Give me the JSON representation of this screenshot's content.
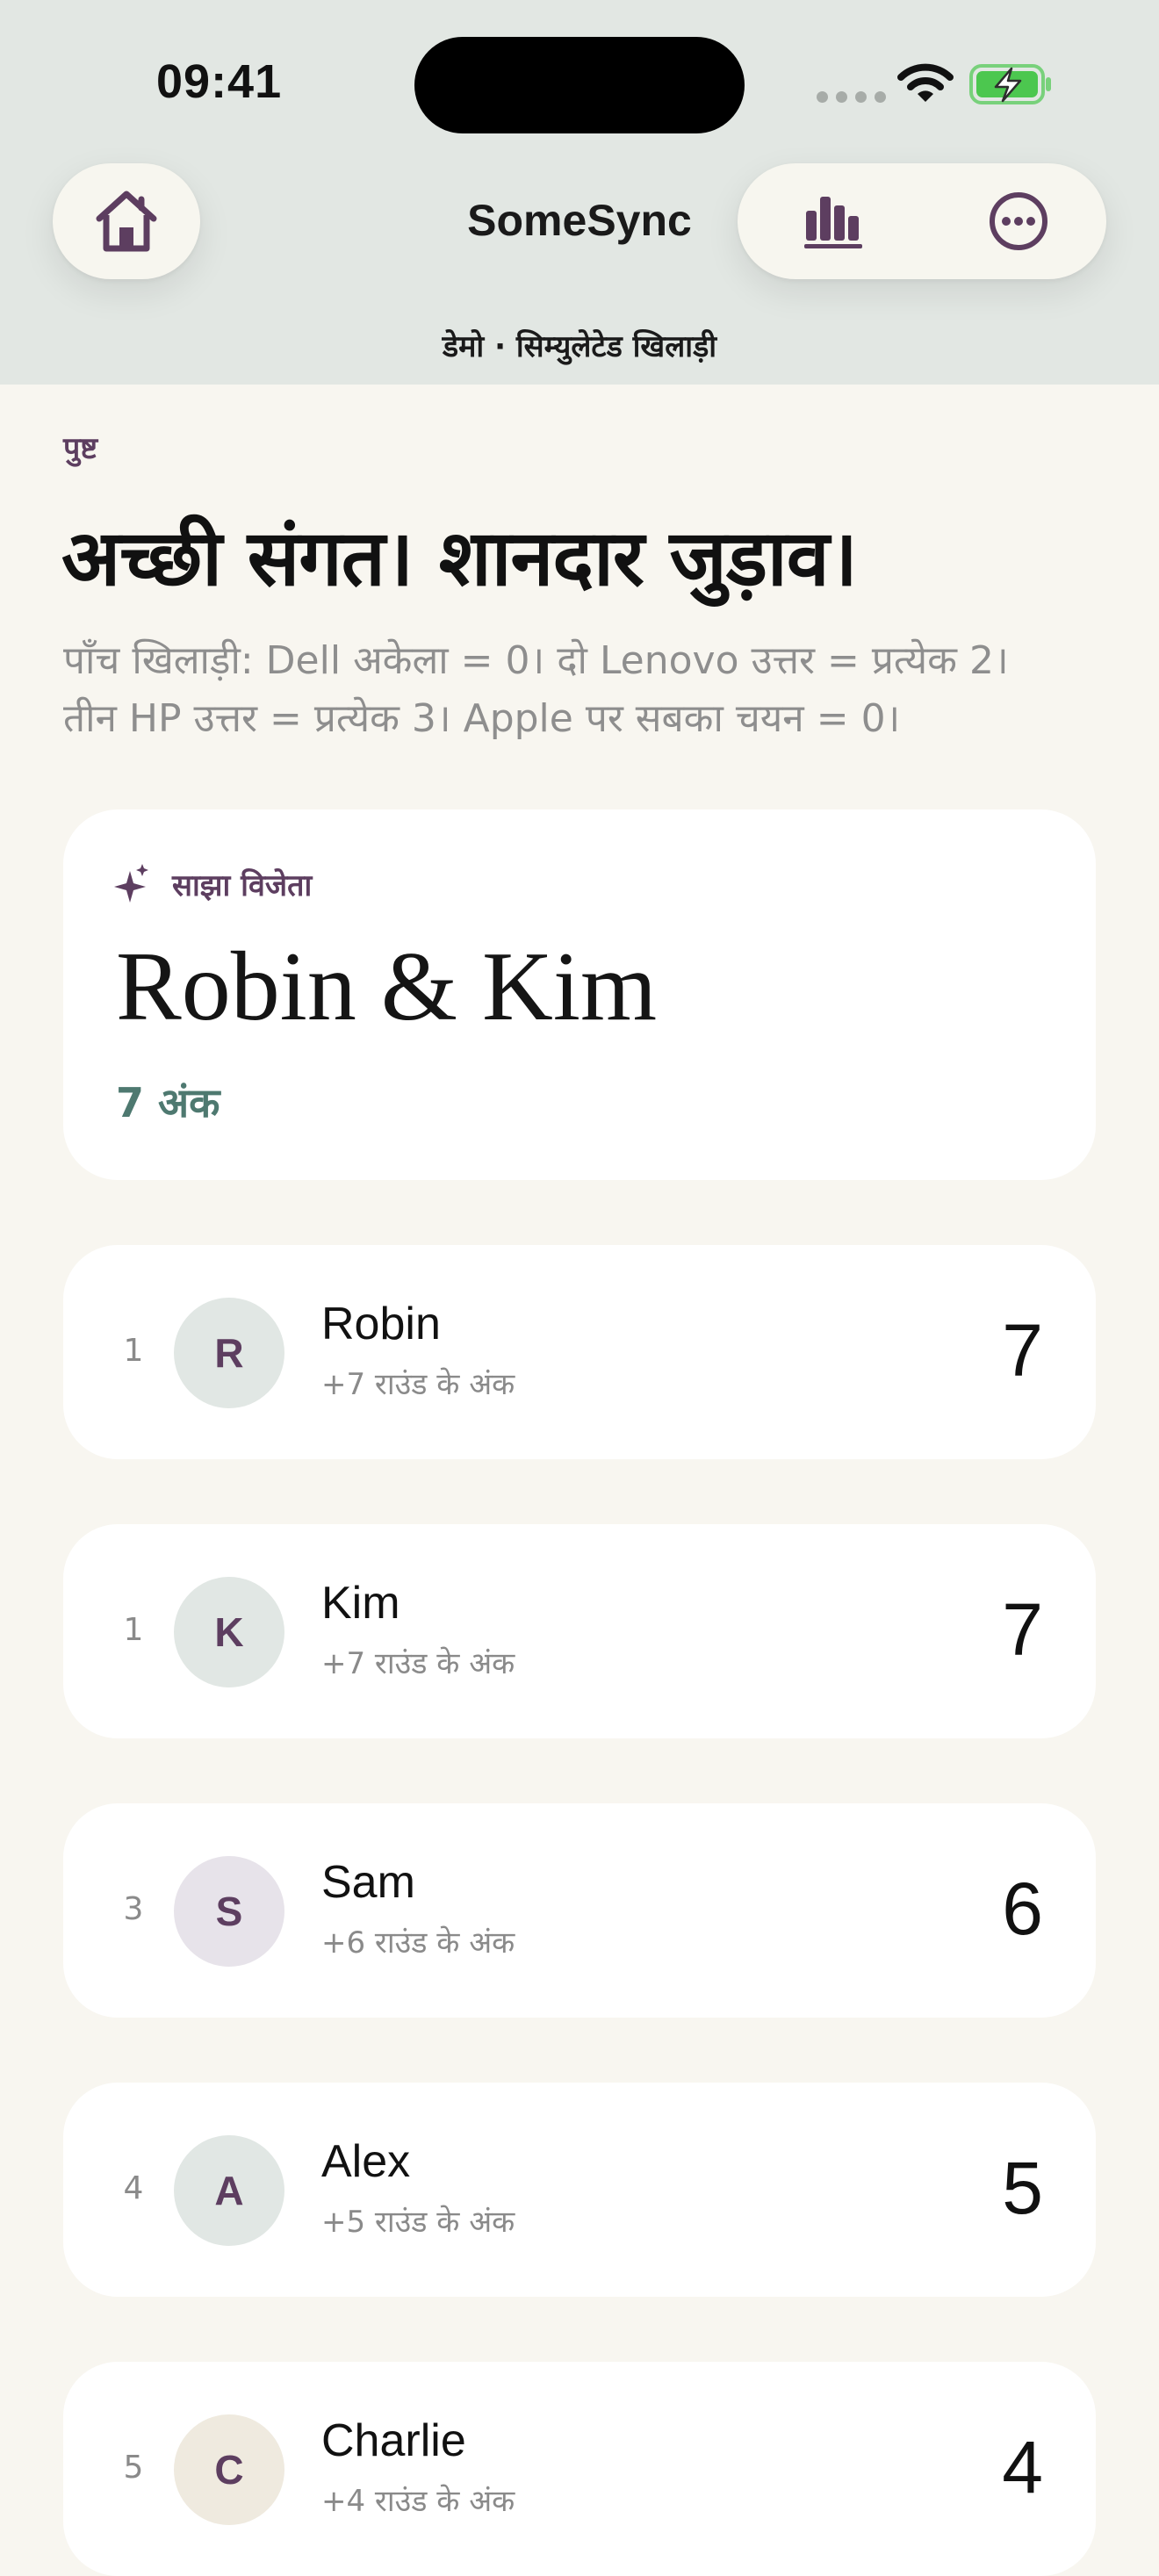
{
  "status_bar": {
    "time": "09:41",
    "icons": [
      "signal-dots-icon",
      "wifi-icon",
      "battery-charging-icon"
    ]
  },
  "nav": {
    "title": "SomeSync",
    "subtitle": "डेमो · सिम्युलेटेड खिलाड़ी",
    "left_icon": "home-icon",
    "right_icons": [
      "bar-chart-icon",
      "more-icon"
    ]
  },
  "page": {
    "eyebrow": "पुष्ट",
    "headline": "अच्छी संगत। शानदार जुड़ाव।",
    "description_line1": "पाँच खिलाड़ी: Dell अकेला = 0। दो Lenovo उत्तर = प्रत्येक 2।",
    "description_line2": "तीन HP उत्तर = प्रत्येक 3। Apple पर सबका चयन = 0।"
  },
  "winner": {
    "label": "साझा विजेता",
    "icon": "sparkle-icon",
    "names": "Robin & Kim",
    "points": "7 अंक"
  },
  "players": [
    {
      "rank": "1",
      "initial": "R",
      "name": "Robin",
      "round_points": "+7 राउंड के अंक",
      "score": "7",
      "avatar_color": "#e1e7e4"
    },
    {
      "rank": "1",
      "initial": "K",
      "name": "Kim",
      "round_points": "+7 राउंड के अंक",
      "score": "7",
      "avatar_color": "#e1e7e4"
    },
    {
      "rank": "3",
      "initial": "S",
      "name": "Sam",
      "round_points": "+6 राउंड के अंक",
      "score": "6",
      "avatar_color": "#e7e3ea"
    },
    {
      "rank": "4",
      "initial": "A",
      "name": "Alex",
      "round_points": "+5 राउंड के अंक",
      "score": "5",
      "avatar_color": "#e1e7e4"
    },
    {
      "rank": "5",
      "initial": "C",
      "name": "Charlie",
      "round_points": "+4 राउंड के अंक",
      "score": "4",
      "avatar_color": "#efeadf"
    }
  ],
  "colors": {
    "header_bg": "#e2e7e3",
    "page_bg": "#f8f6f0",
    "accent_purple": "#5d3e60",
    "accent_green": "#4e7970",
    "battery_green": "#4cc74f"
  }
}
